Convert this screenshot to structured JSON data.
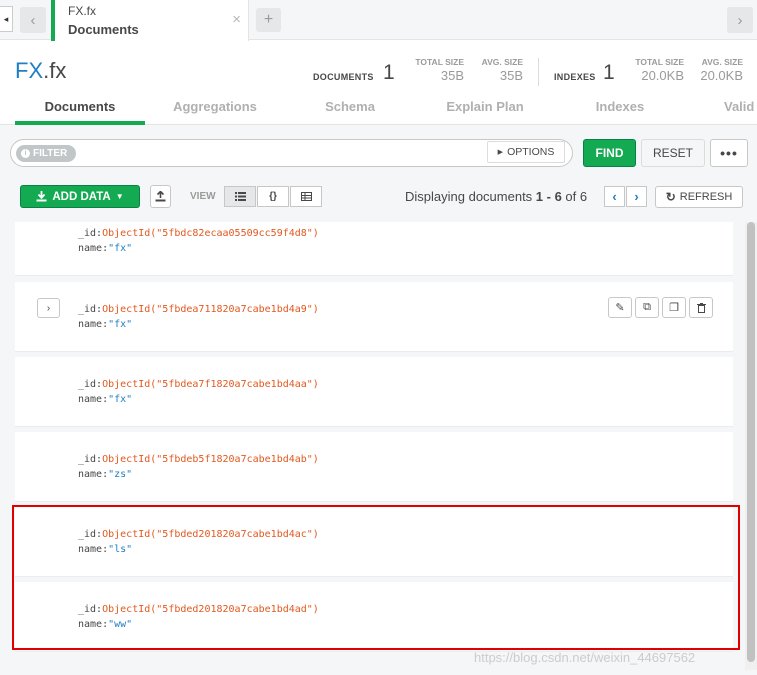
{
  "tab": {
    "namespace": "FX.fx",
    "subtitle": "Documents",
    "close": "×",
    "add": "+"
  },
  "nav": {
    "left": "◂",
    "back": "‹",
    "forward": "›"
  },
  "header": {
    "db": "FX",
    "collection": ".fx",
    "documents_label": "DOCUMENTS",
    "documents_count": "1",
    "total_size_label_1": "TOTAL SIZE",
    "total_size_1": "35B",
    "avg_size_label_1": "AVG. SIZE",
    "avg_size_1": "35B",
    "indexes_label": "INDEXES",
    "indexes_count": "1",
    "total_size_label_2": "TOTAL SIZE",
    "total_size_2": "20.0KB",
    "avg_size_label_2": "AVG. SIZE",
    "avg_size_2": "20.0KB"
  },
  "subtabs": [
    "Documents",
    "Aggregations",
    "Schema",
    "Explain Plan",
    "Indexes",
    "Valid"
  ],
  "filter": {
    "badge": "FILTER",
    "options": "OPTIONS",
    "find": "FIND",
    "reset": "RESET",
    "more": "•••"
  },
  "toolbar": {
    "add_data": "ADD DATA",
    "view_label": "VIEW",
    "view_json": "{}",
    "display_prefix": "Displaying documents ",
    "display_range": "1 - 6",
    "display_of": " of ",
    "display_total": "6",
    "prev": "‹",
    "next": "›",
    "refresh": "REFRESH"
  },
  "documents": [
    {
      "id_key": "_id:",
      "oid": "ObjectId(\"5fbdc82ecaa05509cc59f4d8\")",
      "name_key": "name:",
      "name": "\"fx\""
    },
    {
      "id_key": "_id:",
      "oid": "ObjectId(\"5fbdea711820a7cabe1bd4a9\")",
      "name_key": "name:",
      "name": "\"fx\""
    },
    {
      "id_key": "_id:",
      "oid": "ObjectId(\"5fbdea7f1820a7cabe1bd4aa\")",
      "name_key": "name:",
      "name": "\"fx\""
    },
    {
      "id_key": "_id:",
      "oid": "ObjectId(\"5fbdeb5f1820a7cabe1bd4ab\")",
      "name_key": "name:",
      "name": "\"zs\""
    },
    {
      "id_key": "_id:",
      "oid": "ObjectId(\"5fbded201820a7cabe1bd4ac\")",
      "name_key": "name:",
      "name": "\"ls\""
    },
    {
      "id_key": "_id:",
      "oid": "ObjectId(\"5fbded201820a7cabe1bd4ad\")",
      "name_key": "name:",
      "name": "\"ww\""
    }
  ],
  "watermark": "https://blog.csdn.net/weixin_44697562",
  "colors": {
    "accent": "#13aa52",
    "link": "#1e7fc3",
    "oid": "#e2581e",
    "highlight": "#e00000"
  },
  "icons": [
    "caret-left-icon",
    "chevron-left-icon",
    "close-icon",
    "plus-icon",
    "chevron-right-icon",
    "info-icon",
    "caret-right-icon",
    "download-icon",
    "caret-down-icon",
    "upload-icon",
    "list-icon",
    "braces-icon",
    "table-icon",
    "refresh-icon",
    "expand-icon",
    "edit-icon",
    "copy-icon",
    "clone-icon",
    "trash-icon"
  ]
}
